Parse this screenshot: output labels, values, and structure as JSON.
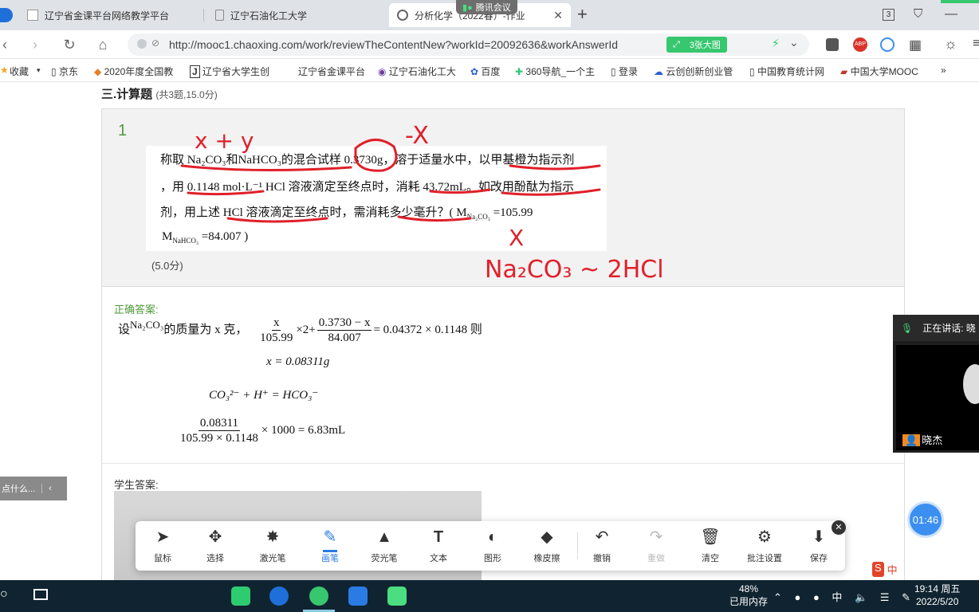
{
  "browser": {
    "tabs": [
      {
        "label": "辽宁省金课平台网络教学平台"
      },
      {
        "label": "辽宁石油化工大学"
      },
      {
        "label": "分析化学（2022春）-作业"
      }
    ],
    "new_tab": "+",
    "url": "http://mooc1.chaoxing.com/work/reviewTheContentNew?workId=20092636&workAnswerId",
    "big_image_button": "3张大图",
    "bookmarks_label": "收藏",
    "bookmarks": [
      "京东",
      "2020年度全国教",
      "辽宁省大学生创",
      "辽宁省金课平台",
      "辽宁石油化工大",
      "百度",
      "360导航_一个主",
      "登录",
      "云创创新创业管",
      "中国教育统计网",
      "中国大学MOOC"
    ],
    "more": "»",
    "meeting_badge": "腾讯会议",
    "tab_count": "3"
  },
  "section": {
    "title": "三.计算题",
    "meta": "(共3题,15.0分)"
  },
  "question": {
    "number": "1",
    "lines": [
      "称取 Na₂CO₃和NaHCO₃的混合试样 0.3730g，溶于适量水中，以甲基橙为指示剂",
      "，用 0.1148 mol·L⁻¹ HCl 溶液滴定至终点时，消耗 43.72mL。如改用酚酞为指示",
      "剂，用上述 HCl 溶液滴定至终点时，需消耗多少毫升？( M",
      "M"
    ],
    "m1_sub": "Na₂CO₃",
    "m1_val": "=105.99",
    "m2_sub": "NaHCO₃",
    "m2_val": "=84.007 )",
    "score": "(5.0分)",
    "handwriting": [
      "x + y",
      "-X",
      "X",
      "Na₂CO₃ ~ 2HCl"
    ]
  },
  "answer": {
    "label": "正确答案:",
    "line1_prefix": "设",
    "line1_species": "Na₂CO₃",
    "line1_text": "的质量为 x 克，",
    "frac1_n": "x",
    "frac1_d": "105.99",
    "times2": "×2+",
    "frac2_n": "0.3730 − x",
    "frac2_d": "84.007",
    "rhs": "= 0.04372 × 0.1148 则",
    "line2": "x = 0.08311g",
    "line3": "CO₃²⁻ + H⁺ = HCO₃⁻",
    "frac3_n": "0.08311",
    "frac3_d": "105.99 × 0.1148",
    "line4_rhs": "× 1000 = 6.83mL"
  },
  "student": {
    "label": "学生答案:"
  },
  "side_hint": "点什么...",
  "call": {
    "speaking_label": "正在讲话: 晓",
    "speaker_name": "晓杰",
    "timer": "01:46"
  },
  "annotation_tools": [
    {
      "label": "鼠标",
      "icon": "cursor-icon"
    },
    {
      "label": "选择",
      "icon": "move-icon"
    },
    {
      "label": "激光笔",
      "icon": "laser-icon"
    },
    {
      "label": "画笔",
      "icon": "pen-icon"
    },
    {
      "label": "荧光笔",
      "icon": "highlighter-icon"
    },
    {
      "label": "文本",
      "icon": "text-icon"
    },
    {
      "label": "图形",
      "icon": "shape-icon"
    },
    {
      "label": "橡皮擦",
      "icon": "eraser-icon"
    },
    {
      "label": "撤销",
      "icon": "undo-icon"
    },
    {
      "label": "重做",
      "icon": "redo-icon"
    },
    {
      "label": "清空",
      "icon": "trash-icon"
    },
    {
      "label": "批注设置",
      "icon": "settings-user-icon"
    },
    {
      "label": "保存",
      "icon": "download-icon"
    }
  ],
  "taskbar": {
    "mem_percent": "48%",
    "mem_label": "已用内存",
    "time": "19:14 周五",
    "date": "2022/5/20",
    "ime": "中"
  }
}
